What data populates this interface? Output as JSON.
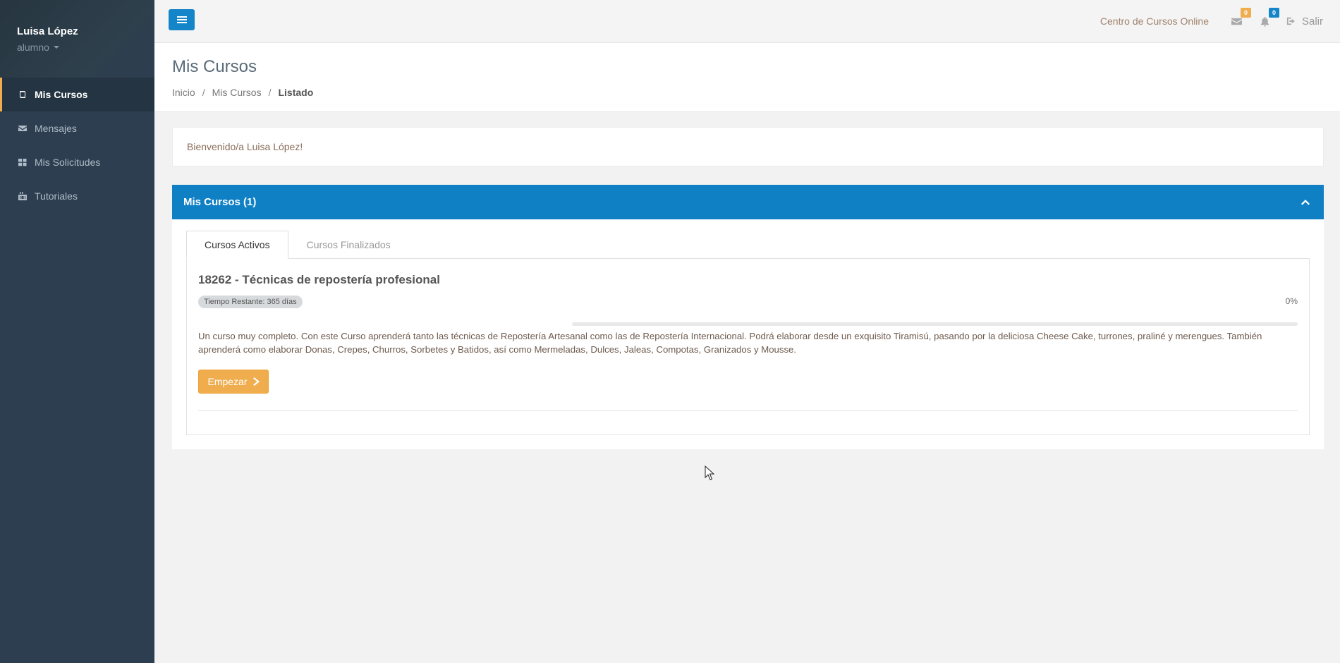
{
  "user": {
    "name": "Luisa López",
    "role": "alumno"
  },
  "sidebar": {
    "items": [
      {
        "label": "Mis Cursos",
        "icon": "book-icon",
        "active": true
      },
      {
        "label": "Mensajes",
        "icon": "envelope-icon",
        "active": false
      },
      {
        "label": "Mis Solicitudes",
        "icon": "grid-icon",
        "active": false
      },
      {
        "label": "Tutoriales",
        "icon": "youtube-icon",
        "active": false
      }
    ]
  },
  "topbar": {
    "site_name": "Centro de Cursos Online",
    "messages_count": "0",
    "notifications_count": "0",
    "logout_label": "Salir"
  },
  "header": {
    "title": "Mis Cursos",
    "breadcrumb": [
      "Inicio",
      "Mis Cursos",
      "Listado"
    ]
  },
  "welcome": "Bienvenido/a Luisa López!",
  "panel": {
    "title": "Mis Cursos (1)",
    "tabs": [
      {
        "label": "Cursos Activos",
        "active": true
      },
      {
        "label": "Cursos Finalizados",
        "active": false
      }
    ]
  },
  "course": {
    "title": "18262 - Técnicas de repostería profesional",
    "time_remaining": "Tiempo Restante: 365 días",
    "progress_label": "0%",
    "progress_value": 0,
    "description": "Un curso muy completo. Con este Curso aprenderá tanto las técnicas de Repostería Artesanal como las de Repostería Internacional. Podrá elaborar desde un exquisito Tiramisú, pasando por la deliciosa Cheese Cake, turrones, praliné y merengues. También aprenderá como elaborar Donas, Crepes, Churros, Sorbetes y Batidos, así como Mermeladas, Dulces, Jaleas, Compotas, Granizados y Mousse.",
    "start_label": "Empezar"
  },
  "colors": {
    "sidebar_bg": "#2c3e50",
    "primary": "#1080c5",
    "accent": "#f0ad4e"
  }
}
